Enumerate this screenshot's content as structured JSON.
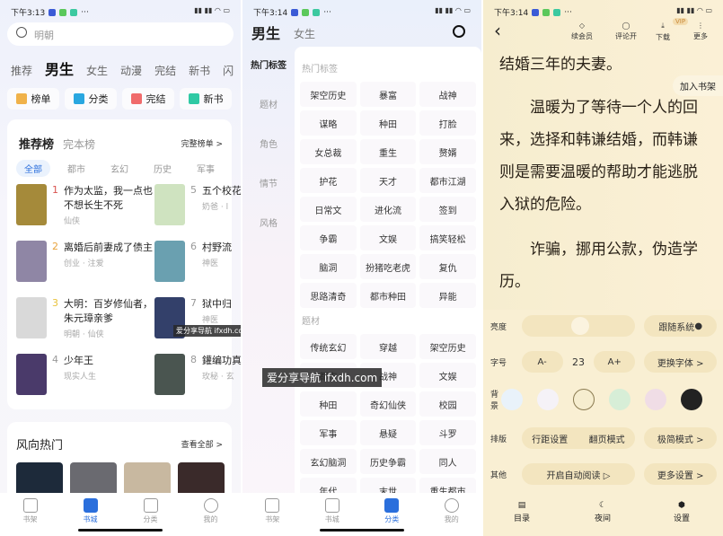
{
  "watermark": "爱分享导航 ifxdh.com",
  "p1": {
    "time": "下午3:13",
    "battery": "96",
    "search_placeholder": "明朝",
    "tabs": [
      "推荐",
      "男生",
      "女生",
      "动漫",
      "完结",
      "新书",
      "闪"
    ],
    "quick": [
      {
        "label": "榜单",
        "color": "#f0b24a"
      },
      {
        "label": "分类",
        "color": "#29a7e0"
      },
      {
        "label": "完结",
        "color": "#f06b6b"
      },
      {
        "label": "新书",
        "color": "#2fc9a4"
      }
    ],
    "rank": {
      "title": "推荐榜",
      "alt": "完本榜",
      "more": "完整榜单 >",
      "filters": [
        "全部",
        "都市",
        "玄幻",
        "历史",
        "军事"
      ],
      "books": [
        {
          "rank": "1",
          "title": "作为太监，我一点也不想长生不死",
          "meta": "仙侠",
          "cover": "#a58a3a"
        },
        {
          "rank": "2",
          "title": "离婚后前妻成了债主",
          "meta": "创业 · 注爱",
          "cover": "#8f86a5"
        },
        {
          "rank": "3",
          "title": "大明：百岁修仙者，朱元璋亲爹",
          "meta": "明朝 · 仙侠",
          "cover": "#d9d9d9"
        },
        {
          "rank": "4",
          "title": "少年王",
          "meta": "现实人生",
          "cover": "#4a3a6a"
        },
        {
          "rank": "5",
          "title": "五个校花叫我爸",
          "meta": "奶爸 · l",
          "cover": "#cfe3c0"
        },
        {
          "rank": "6",
          "title": "村野流",
          "meta": "神医",
          "cover": "#6aa0b0"
        },
        {
          "rank": "7",
          "title": "狱中归",
          "meta": "神医",
          "cover": "#33406a"
        },
        {
          "rank": "8",
          "title": "鑵编功真练成",
          "meta": "玫秘 · 玄",
          "cover": "#4a5550"
        }
      ]
    },
    "hot": {
      "title": "风向热门",
      "more": "查看全部 >",
      "covers": [
        "#1d2a3a",
        "#6a6a70",
        "#c8b8a0",
        "#3a2a2a"
      ]
    },
    "nav": [
      "书架",
      "书城",
      "分类",
      "我的"
    ]
  },
  "p2": {
    "time": "下午3:14",
    "tabs": [
      "男生",
      "女生"
    ],
    "side": [
      "热门标签",
      "题材",
      "角色",
      "情节",
      "风格"
    ],
    "sections": [
      {
        "title": "热门标签",
        "tags": [
          "架空历史",
          "暴富",
          "战神",
          "谋略",
          "种田",
          "打脸",
          "女总裁",
          "重生",
          "赘婿",
          "护花",
          "天才",
          "都市江湖",
          "日常文",
          "进化流",
          "签到",
          "争霸",
          "文娱",
          "搞笑轻松",
          "脑洞",
          "扮猪吃老虎",
          "复仇",
          "思路清奇",
          "都市种田",
          "异能"
        ]
      },
      {
        "title": "题材",
        "tags": [
          "传统玄幻",
          "穿越",
          "架空历史",
          "都市",
          "战神",
          "文娱",
          "种田",
          "奇幻仙侠",
          "校园",
          "军事",
          "悬疑",
          "斗罗",
          "玄幻脑洞",
          "历史争霸",
          "同人",
          "年代",
          "末世",
          "重生都市"
        ]
      }
    ],
    "nav": [
      "书架",
      "书城",
      "分类",
      "我的"
    ]
  },
  "p3": {
    "time": "下午3:14",
    "top": [
      "续会员",
      "评论开",
      "下载",
      "更多"
    ],
    "vip": "VIP",
    "add_shelf": "加入书架",
    "lines": [
      "结婚三年的夫妻。",
      "　　温暖为了等待一个人的回",
      "来，选择和韩谦结婚，而韩谦",
      "则是需要温暖的帮助才能逃脱",
      "入狱的危险。",
      "　　诈骗，挪用公款，伪造学",
      "历。"
    ],
    "settings": {
      "brightness": {
        "label": "亮度",
        "value": 0.45,
        "follow": "跟随系统"
      },
      "font": {
        "label": "字号",
        "minus": "A-",
        "size": "23",
        "plus": "A+",
        "change": "更换字体 >"
      },
      "bg": {
        "label": "背景",
        "colors": [
          "#e9f2fa",
          "#f5f2f7",
          "#f6edcf",
          "#d7eed7",
          "#f0dde6",
          "#222222"
        ]
      },
      "layout": {
        "label": "排版",
        "spacing": "行距设置",
        "page": "翻页模式",
        "simple": "极简模式 >"
      },
      "other": {
        "label": "其他",
        "auto": "开启自动阅读 ▷",
        "more": "更多设置 >"
      }
    },
    "bottom": [
      "目录",
      "夜间",
      "设置"
    ]
  }
}
